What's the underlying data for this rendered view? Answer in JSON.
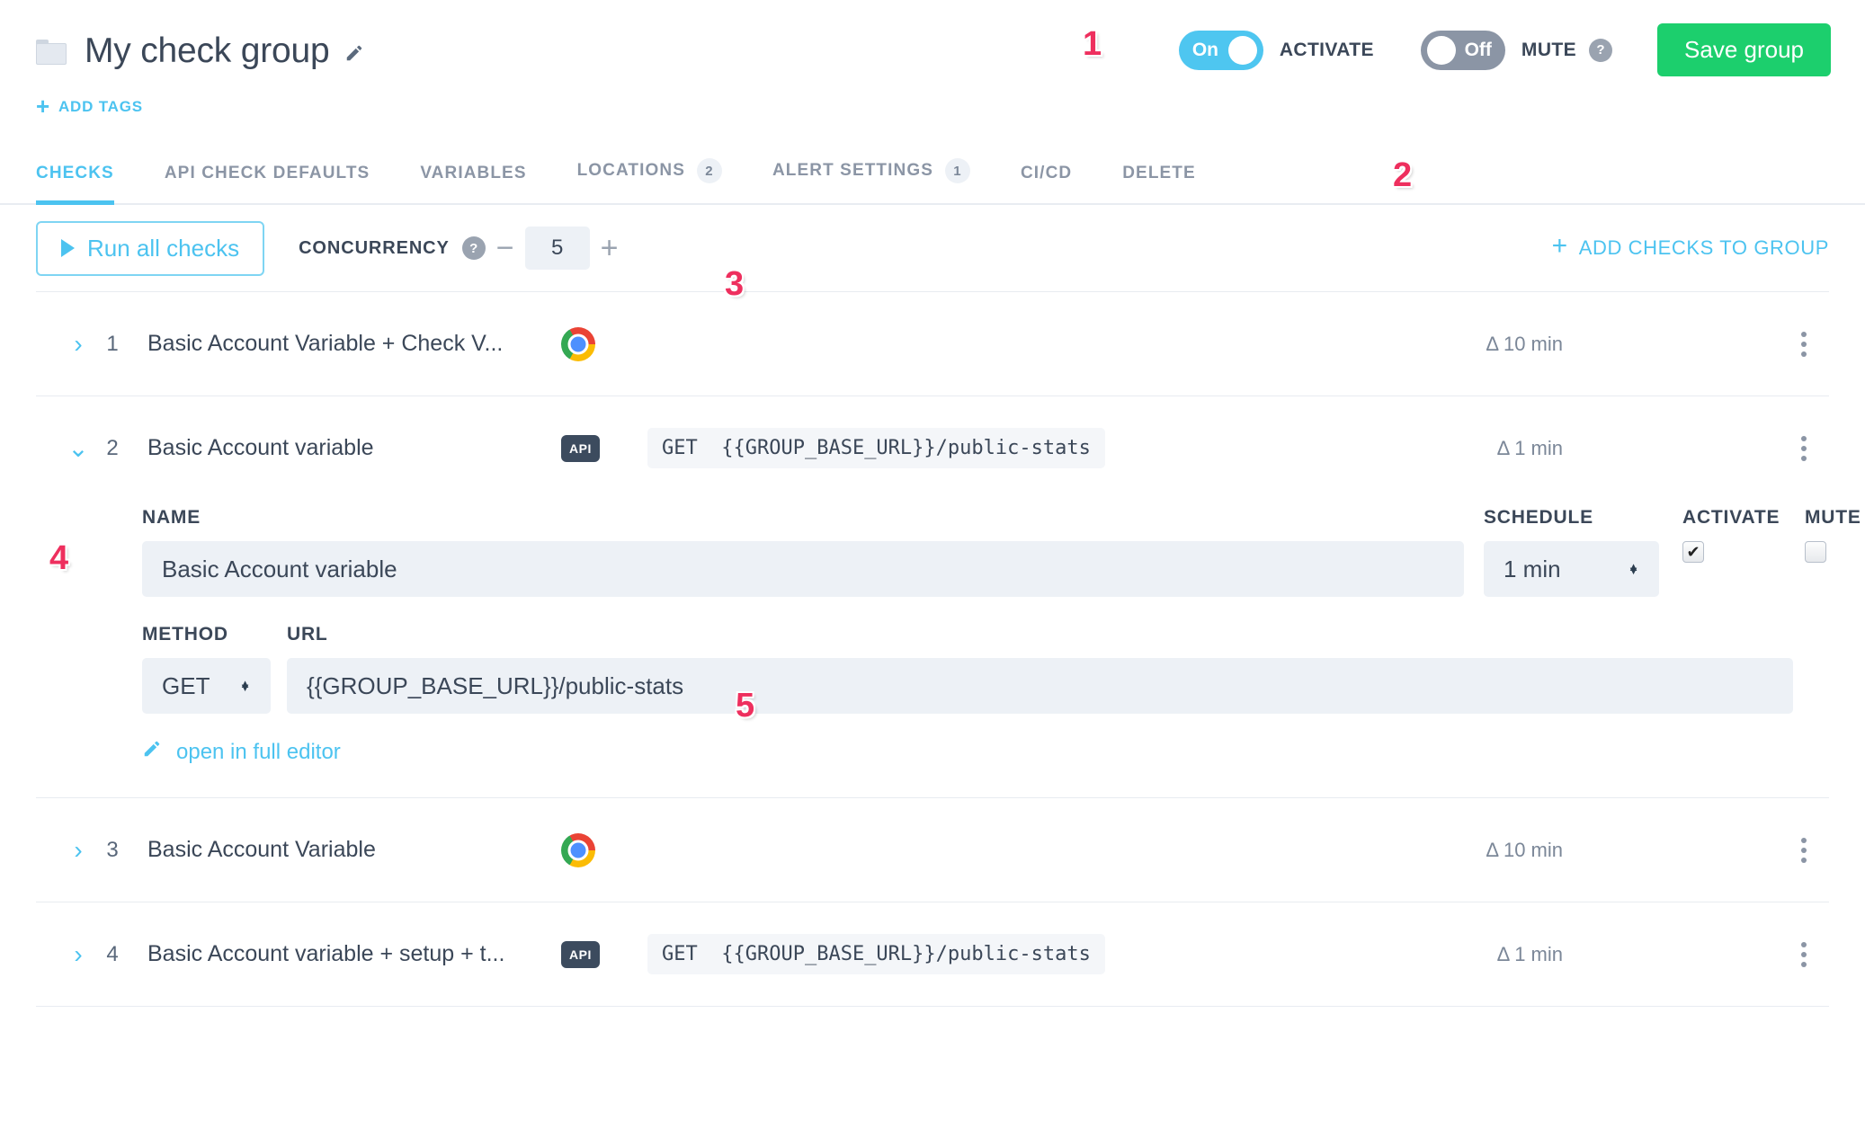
{
  "header": {
    "folder_icon": "folder-icon",
    "group_title": "My check group",
    "edit_icon": "pencil-icon",
    "add_tags_plus": "+",
    "add_tags_label": "ADD TAGS",
    "activate_toggle": {
      "state": "On",
      "label": "ACTIVATE"
    },
    "mute_toggle": {
      "state": "Off",
      "label": "MUTE",
      "help": "?"
    },
    "save_button": "Save group"
  },
  "tabs": [
    {
      "label": "CHECKS",
      "badge": "",
      "active": true
    },
    {
      "label": "API CHECK DEFAULTS",
      "badge": "",
      "active": false
    },
    {
      "label": "VARIABLES",
      "badge": "",
      "active": false
    },
    {
      "label": "LOCATIONS",
      "badge": "2",
      "active": false
    },
    {
      "label": "ALERT SETTINGS",
      "badge": "1",
      "active": false
    },
    {
      "label": "CI/CD",
      "badge": "",
      "active": false
    },
    {
      "label": "DELETE",
      "badge": "",
      "active": false
    }
  ],
  "toolbar": {
    "run_all_label": "Run all checks",
    "concurrency_label": "CONCURRENCY",
    "concurrency_help": "?",
    "minus": "−",
    "plus": "+",
    "concurrency_value": "5",
    "add_checks_plus": "+",
    "add_checks_label": "ADD CHECKS TO GROUP"
  },
  "checks": [
    {
      "index": "1",
      "chevron": "›",
      "name": "Basic Account Variable + Check V...",
      "type": "browser",
      "method": "",
      "url": "",
      "schedule": "Δ 10 min",
      "expanded": false
    },
    {
      "index": "2",
      "chevron": "⌄",
      "name": "Basic Account variable",
      "type": "api",
      "type_badge": "API",
      "method": "GET",
      "url": "{{GROUP_BASE_URL}}/public-stats",
      "schedule": "Δ 1 min",
      "expanded": true
    },
    {
      "index": "3",
      "chevron": "›",
      "name": "Basic Account Variable",
      "type": "browser",
      "method": "",
      "url": "",
      "schedule": "Δ 10 min",
      "expanded": false
    },
    {
      "index": "4",
      "chevron": "›",
      "name": "Basic Account variable + setup + t...",
      "type": "api",
      "type_badge": "API",
      "method": "GET",
      "url": "{{GROUP_BASE_URL}}/public-stats",
      "schedule": "Δ 1 min",
      "expanded": false
    }
  ],
  "detail": {
    "name_label": "NAME",
    "name_value": "Basic Account variable",
    "schedule_label": "SCHEDULE",
    "schedule_value": "1 min",
    "activate_label": "ACTIVATE",
    "activate_checked": "✔",
    "mute_label": "MUTE",
    "mute_checked": "",
    "method_label": "METHOD",
    "method_value": "GET",
    "url_label": "URL",
    "url_value": "{{GROUP_BASE_URL}}/public-stats",
    "full_editor_label": "open in full editor"
  },
  "markers": {
    "m1": "1",
    "m2": "2",
    "m3": "3",
    "m4": "4",
    "m5": "5"
  },
  "colors": {
    "accent_cyan": "#4cc3f0",
    "save_green": "#1ccf6d",
    "marker_pink": "#ee2f5e",
    "toggle_off_gray": "#8b95a5",
    "api_badge_dark": "#3c4b5e",
    "field_bg": "#edf1f6"
  }
}
